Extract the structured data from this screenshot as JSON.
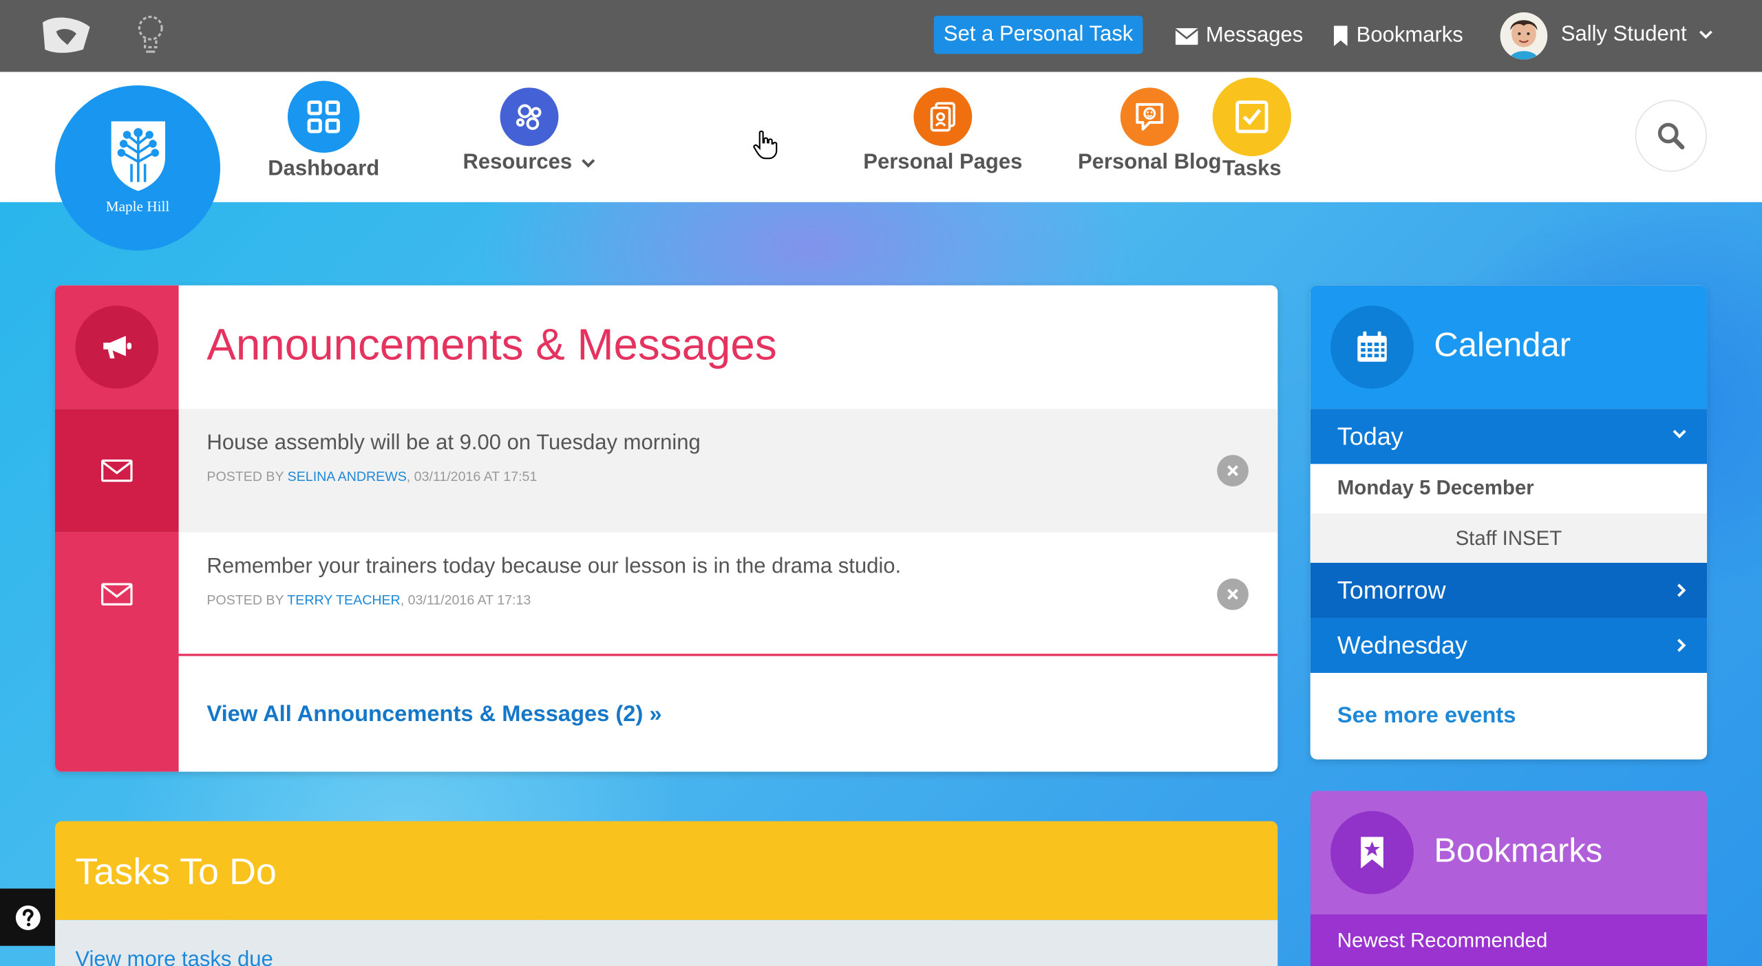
{
  "topbar": {
    "set_task_label": "Set a Personal Task",
    "messages_label": "Messages",
    "bookmarks_label": "Bookmarks",
    "user_name": "Sally Student"
  },
  "school": {
    "name": "Maple Hill"
  },
  "nav": {
    "dashboard": "Dashboard",
    "resources": "Resources",
    "tasks": "Tasks",
    "personal_pages": "Personal Pages",
    "personal_blog": "Personal Blog"
  },
  "announcements": {
    "title": "Announcements & Messages",
    "items": [
      {
        "text": "House assembly will be at 9.00 on Tuesday morning",
        "posted_by": "POSTED BY",
        "author": "SELINA ANDREWS",
        "datetime": ", 03/11/2016 AT 17:51"
      },
      {
        "text": "Remember your trainers today because our lesson is in the drama studio.",
        "posted_by": "POSTED BY",
        "author": "TERRY TEACHER",
        "datetime": ", 03/11/2016 AT 17:13"
      }
    ],
    "view_all": "View All Announcements & Messages (2) »"
  },
  "tasks_panel": {
    "title": "Tasks To Do",
    "more_link": "View more tasks due"
  },
  "calendar": {
    "title": "Calendar",
    "today_label": "Today",
    "today_date": "Monday 5 December",
    "today_event": "Staff INSET",
    "tomorrow_label": "Tomorrow",
    "wednesday_label": "Wednesday",
    "see_more": "See more events"
  },
  "bookmarks_panel": {
    "title": "Bookmarks",
    "subheading": "Newest Recommended"
  },
  "colors": {
    "topbar": "#5c5c5c",
    "primary_blue": "#1896f0",
    "announcement_red": "#e4335e",
    "tasks_yellow": "#f9c21c",
    "bookmarks_purple": "#b05ed9",
    "link_blue": "#1477c8"
  }
}
